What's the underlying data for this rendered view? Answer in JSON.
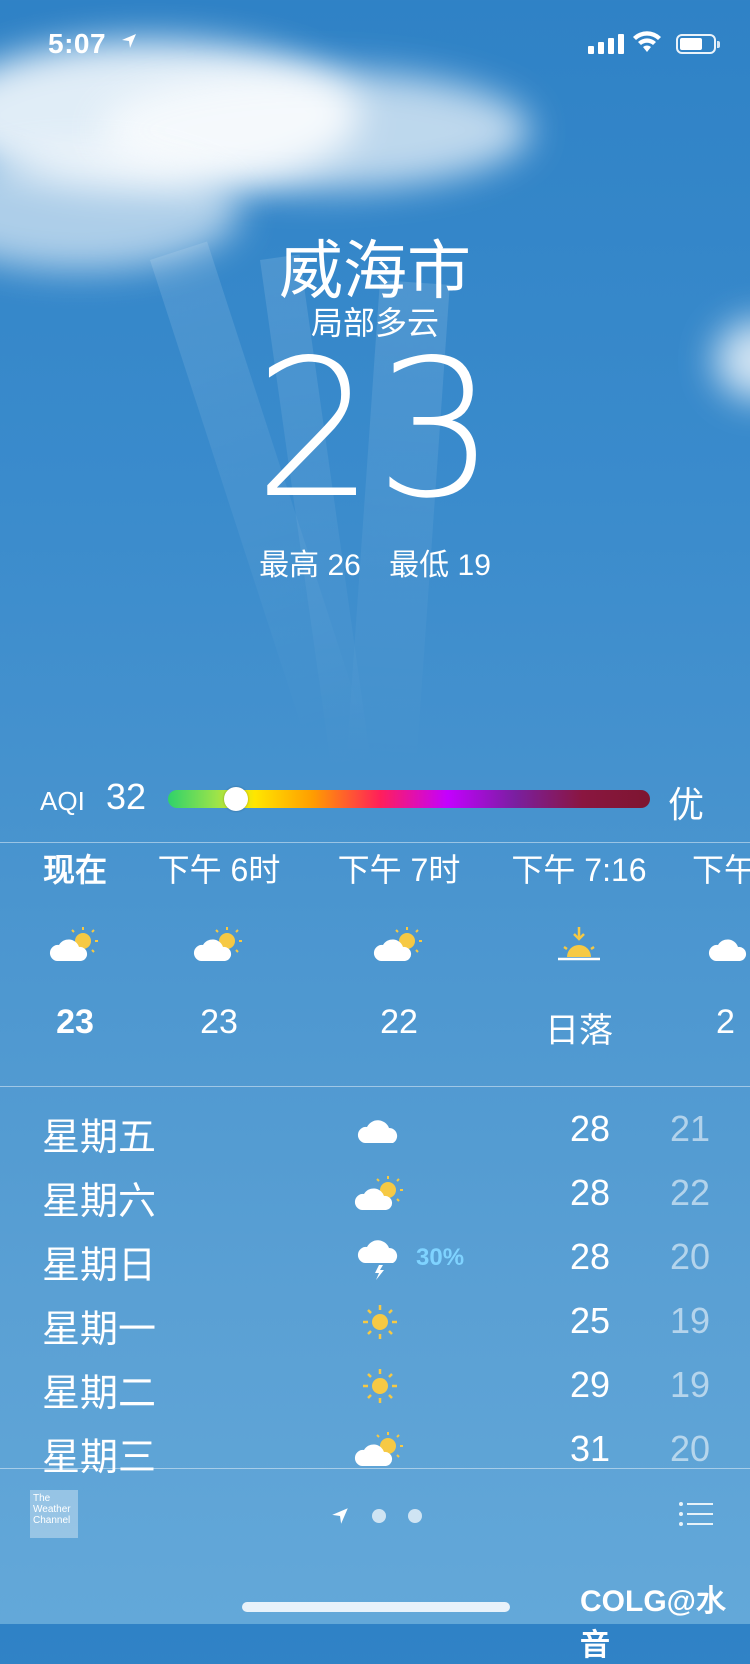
{
  "status": {
    "time": "5:07"
  },
  "header": {
    "city": "威海市",
    "condition": "局部多云",
    "temperature": "23",
    "high": "最高 26",
    "low": "最低 19"
  },
  "aqi": {
    "label": "AQI",
    "value": "32",
    "level": "优",
    "position": 0.1
  },
  "hourly": [
    {
      "time": "现在",
      "icon": "partly-cloudy-icon",
      "temp": "23"
    },
    {
      "time": "下午 6时",
      "icon": "partly-cloudy-icon",
      "temp": "23"
    },
    {
      "time": "下午 7时",
      "icon": "partly-cloudy-icon",
      "temp": "22"
    },
    {
      "time": "下午 7:16",
      "icon": "sunset-icon",
      "temp": "日落"
    },
    {
      "time": "下午",
      "icon": "partly-cloudy-icon",
      "temp": "2"
    }
  ],
  "daily": [
    {
      "day": "星期五",
      "icon": "cloud-icon",
      "pct": "",
      "high": "28",
      "low": "21"
    },
    {
      "day": "星期六",
      "icon": "partly-cloudy-icon",
      "pct": "",
      "high": "28",
      "low": "22"
    },
    {
      "day": "星期日",
      "icon": "thunderstorm-icon",
      "pct": "30%",
      "high": "28",
      "low": "20"
    },
    {
      "day": "星期一",
      "icon": "sun-icon",
      "pct": "",
      "high": "25",
      "low": "19"
    },
    {
      "day": "星期二",
      "icon": "sun-icon",
      "pct": "",
      "high": "29",
      "low": "19"
    },
    {
      "day": "星期三",
      "icon": "partly-cloudy-icon",
      "pct": "",
      "high": "31",
      "low": "20"
    }
  ],
  "footer": {
    "provider": "The Weather Channel",
    "watermark": "COLG@水音"
  },
  "colors": {
    "accent_precip": "#7fd3ff"
  }
}
